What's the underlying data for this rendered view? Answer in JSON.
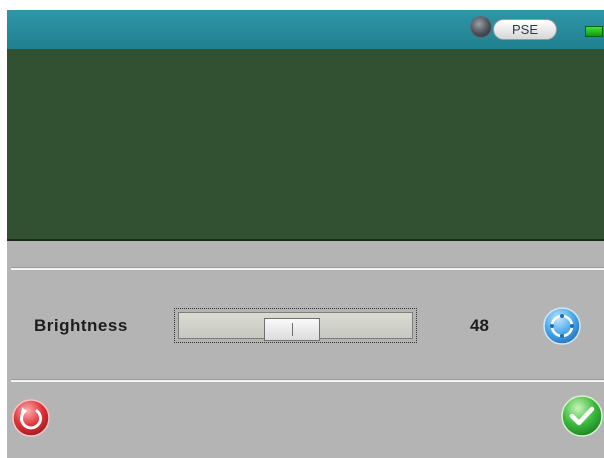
{
  "status_bar": {
    "pse_label": "PSE",
    "pse_indicator_color": "#4a4f58",
    "battery_color": "#22b022"
  },
  "preview": {
    "background_color": "#325133"
  },
  "brightness": {
    "label": "Brightness",
    "value": "48",
    "slider_fraction": 0.48
  },
  "icons": {
    "auto": "auto-adjust-icon",
    "reset": "reset-icon",
    "confirm": "confirm-check-icon"
  },
  "colors": {
    "top_bar": "#2891a3",
    "panel": "#b4b4b4",
    "reset_red": "#d8323a",
    "confirm_green": "#37b23a",
    "auto_blue": "#3a9fe0"
  }
}
